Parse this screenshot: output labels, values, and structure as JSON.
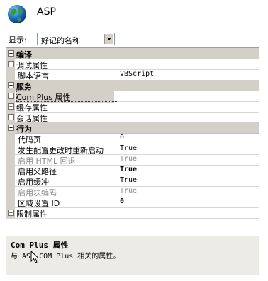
{
  "header": {
    "title": "ASP"
  },
  "toolbar": {
    "show_label": "显示:",
    "sort_value": "好记的名称"
  },
  "grid": {
    "rows": [
      {
        "type": "cat",
        "toggle": "⊟",
        "name": "编译"
      },
      {
        "type": "sub",
        "toggle": "⊞",
        "name": "调试属性",
        "value": ""
      },
      {
        "type": "item",
        "name": "脚本语言",
        "value": "VBScript"
      },
      {
        "type": "cat",
        "toggle": "⊟",
        "name": "服务"
      },
      {
        "type": "sub",
        "toggle": "⊞",
        "name": "Com Plus 属性",
        "value": ""
      },
      {
        "type": "sub",
        "toggle": "⊞",
        "name": "缓存属性",
        "value": ""
      },
      {
        "type": "sub",
        "toggle": "⊞",
        "name": "会话属性",
        "value": ""
      },
      {
        "type": "cat",
        "toggle": "⊟",
        "name": "行为"
      },
      {
        "type": "item",
        "name": "代码页",
        "value": "0"
      },
      {
        "type": "item",
        "name": "发生配置更改时重新启动",
        "value": "True"
      },
      {
        "type": "item",
        "name": "启用 HTML 回退",
        "value": "True",
        "disabled": true
      },
      {
        "type": "item",
        "name": "启用父路径",
        "value": "True",
        "bold": true
      },
      {
        "type": "item",
        "name": "启用缓冲",
        "value": "True"
      },
      {
        "type": "item",
        "name": "启用块编码",
        "value": "True",
        "disabled": true
      },
      {
        "type": "item",
        "name": "区域设置 ID",
        "value": "0",
        "bold": true
      },
      {
        "type": "sub",
        "toggle": "⊞",
        "name": "限制属性",
        "value": ""
      }
    ]
  },
  "description": {
    "title": "Com Plus 属性",
    "text": "与 ASP COM Plus 相关的属性。"
  },
  "colors": {
    "category_bg": "#d4d0c8",
    "disabled_text": "#8a8a8a",
    "desc_bg": "#ecebe6"
  }
}
